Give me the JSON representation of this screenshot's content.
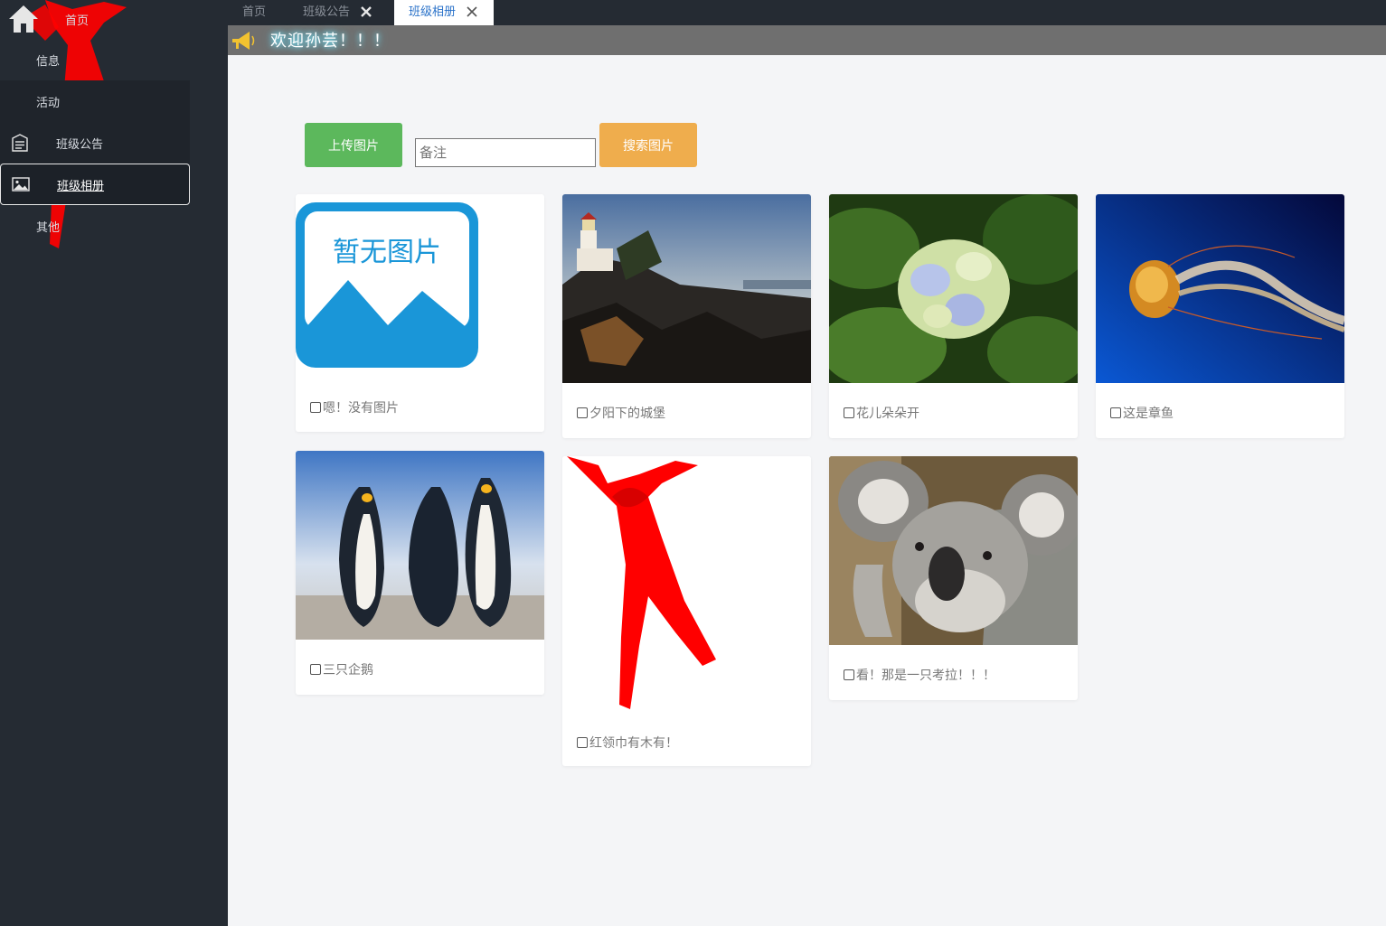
{
  "sidebar": {
    "home": "首页",
    "items": [
      {
        "label": "信息"
      },
      {
        "label": "活动"
      },
      {
        "label": "班级公告"
      },
      {
        "label": "班级相册"
      },
      {
        "label": "其他"
      }
    ]
  },
  "tabs": [
    {
      "label": "首页"
    },
    {
      "label": "班级公告"
    },
    {
      "label": "班级相册"
    }
  ],
  "welcome": "欢迎孙芸！！！",
  "toolbar": {
    "upload_label": "上传图片",
    "note_placeholder": "备注",
    "search_label": "搜索图片"
  },
  "placeholder_image_text": "暂无图片",
  "photos": [
    {
      "caption": "嗯！没有图片"
    },
    {
      "caption": "夕阳下的城堡"
    },
    {
      "caption": "花儿朵朵开"
    },
    {
      "caption": "这是章鱼"
    },
    {
      "caption": "三只企鹅"
    },
    {
      "caption": "红领巾有木有！"
    },
    {
      "caption": "看！那是一只考拉！！！"
    }
  ],
  "colors": {
    "sidebar_bg": "#252b33",
    "upload_button": "#5cb85c",
    "search_button": "#efad4d",
    "active_tab_text": "#2a72c9",
    "scarf_red": "#ff0000"
  }
}
